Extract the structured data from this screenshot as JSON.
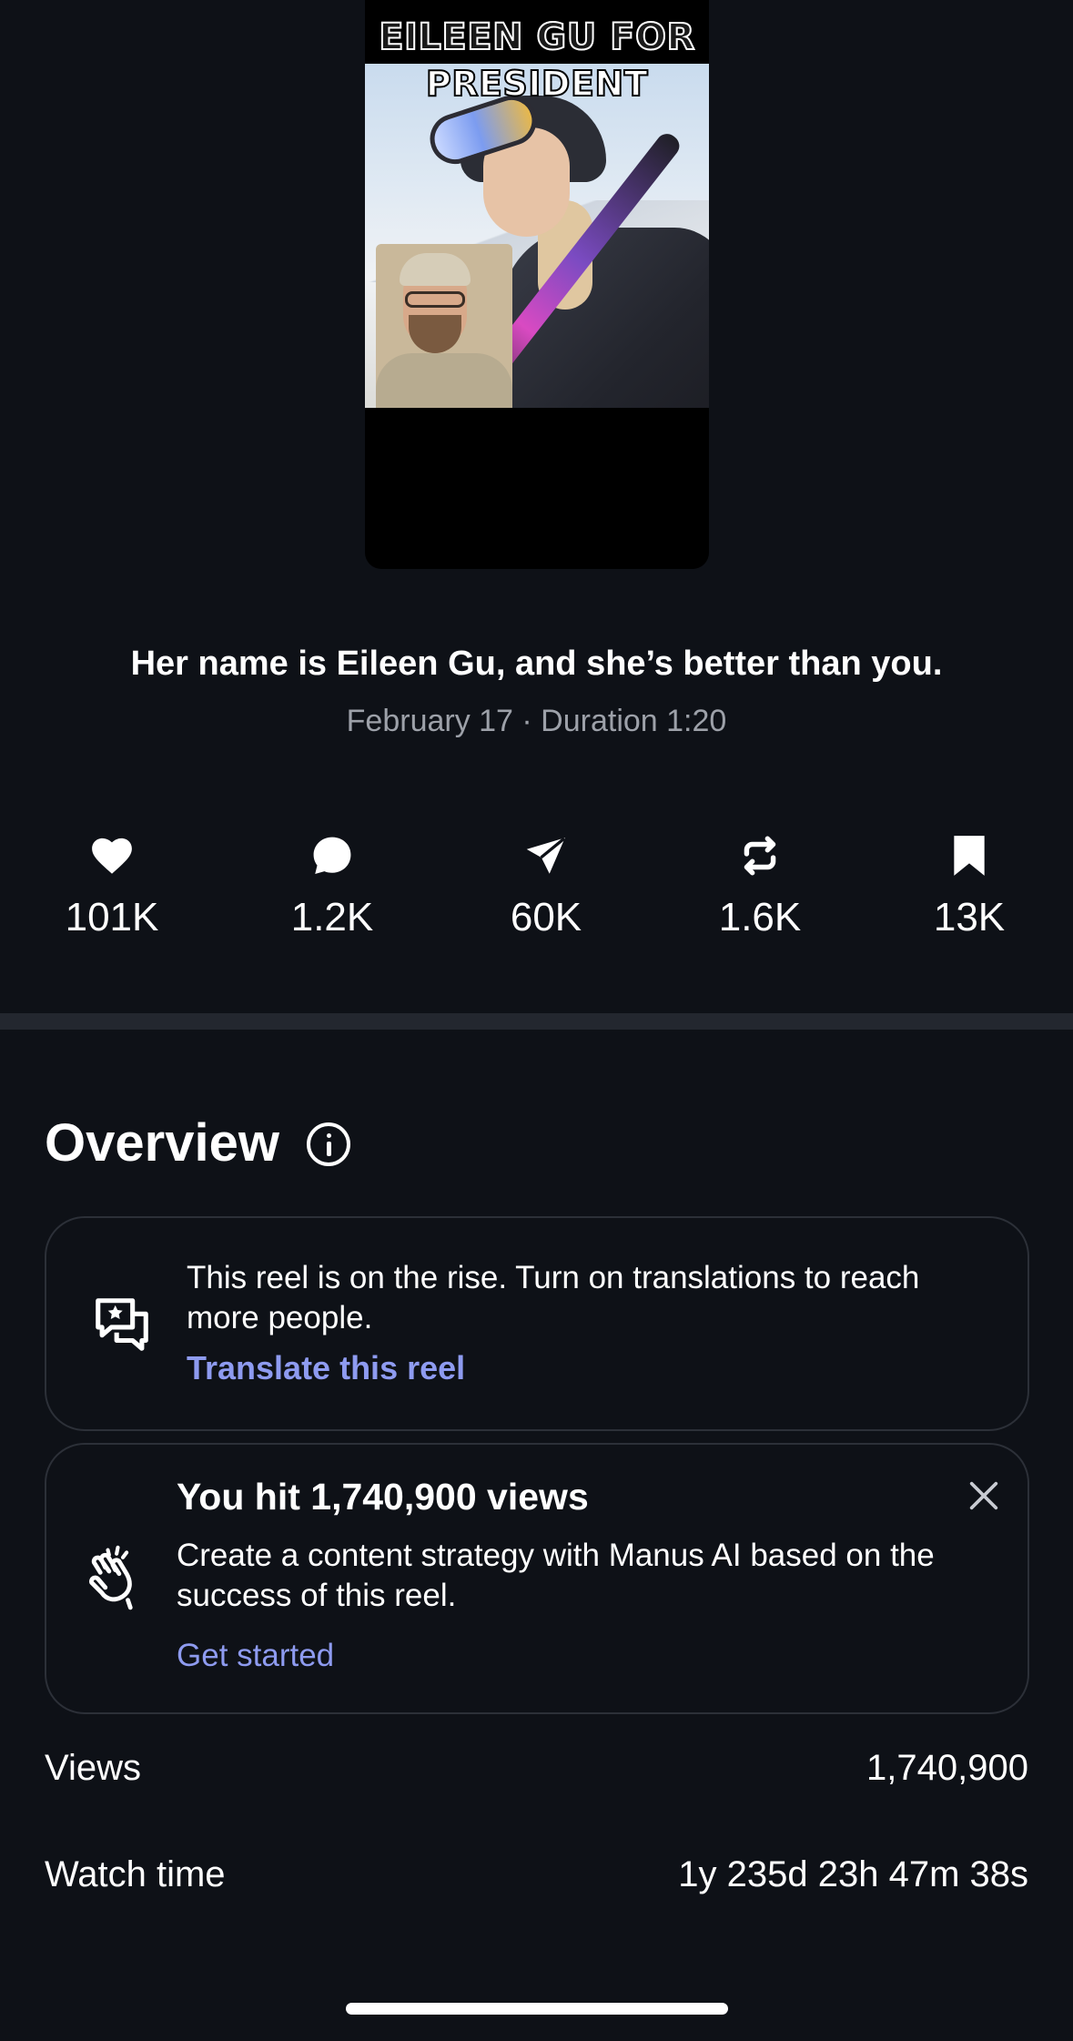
{
  "reel": {
    "thumbnail_text_line1": "EILEEN GU FOR",
    "thumbnail_text_line2": "PRESIDENT",
    "caption": "Her name is Eileen Gu, and she’s better than you.",
    "meta": "February 17 · Duration 1:20"
  },
  "stats": [
    {
      "icon": "heart-icon",
      "value": "101K"
    },
    {
      "icon": "comment-icon",
      "value": "1.2K"
    },
    {
      "icon": "share-icon",
      "value": "60K"
    },
    {
      "icon": "repost-icon",
      "value": "1.6K"
    },
    {
      "icon": "bookmark-icon",
      "value": "13K"
    }
  ],
  "overview": {
    "title": "Overview",
    "translation_card": {
      "text": "This reel is on the rise. Turn on translations to reach more people.",
      "link": "Translate this reel"
    },
    "milestone_card": {
      "title": "You hit 1,740,900 views",
      "text": "Create a content strategy with Manus AI based on the success of this reel.",
      "link": "Get started"
    },
    "rows": [
      {
        "label": "Views",
        "value": "1,740,900"
      },
      {
        "label": "Watch time",
        "value": "1y 235d 23h 47m 38s"
      }
    ]
  },
  "colors": {
    "background": "#0e1117",
    "link": "#8e9bf0",
    "muted_text": "#9da1a9",
    "divider": "#23272f"
  }
}
